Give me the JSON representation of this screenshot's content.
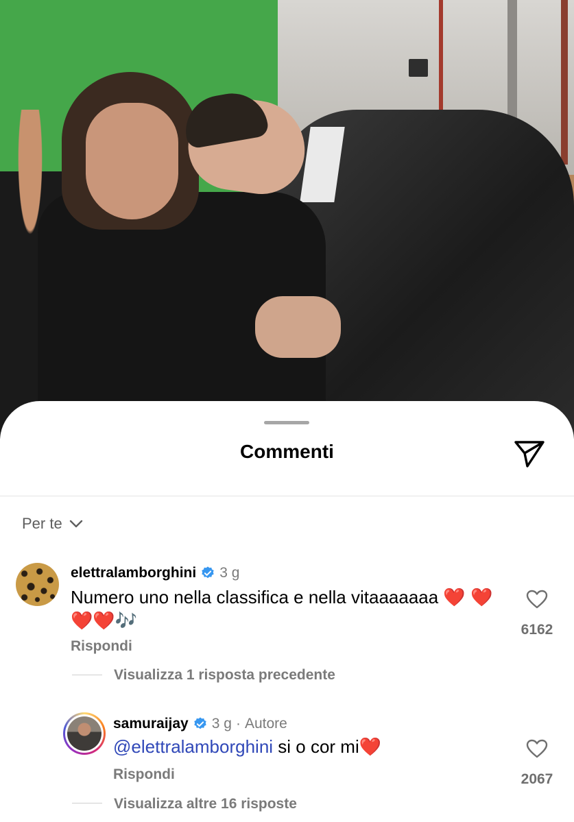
{
  "photo": {
    "alt_name": "post-photo"
  },
  "sheet": {
    "title": "Commenti",
    "sort_label": "Per te"
  },
  "comments": [
    {
      "username": "elettralamborghini",
      "verified": true,
      "time": "3 g",
      "text": "Numero uno nella classifica e nella vitaaaaaaa ❤️ ❤️❤️❤️🎶",
      "reply_label": "Rispondi",
      "likes": "6162",
      "thread_label": "Visualizza 1 risposta precedente"
    },
    {
      "username": "samuraijay",
      "verified": true,
      "time": "3 g",
      "separator": "·",
      "author_label": "Autore",
      "mention": "@elettralamborghini",
      "text": " si o cor mi❤️",
      "reply_label": "Rispondi",
      "likes": "2067",
      "thread_label": "Visualizza altre 16 risposte"
    }
  ],
  "colors": {
    "verified": "#3797f0",
    "mention": "#3048b8",
    "secondary_text": "#7a7a7a"
  }
}
